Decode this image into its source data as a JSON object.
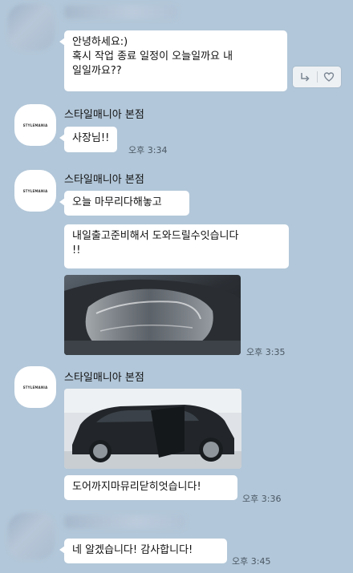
{
  "messages": {
    "m1": {
      "text": "안녕하세요:)\n혹시 작업 종료 일정이 오늘일까요 내\n일일까요??"
    },
    "group1": {
      "sender": "스타일매니아 본점",
      "b1": "사장님!!",
      "time": "오후 3:34"
    },
    "group2": {
      "sender": "스타일매니아 본점",
      "b1": "오늘 마무리다해놓고",
      "b2": "내일출고준비해서 도와드릴수잇습니다\n!!",
      "time": "오후 3:35"
    },
    "group3": {
      "sender": "스타일매니아 본점",
      "b1": "도어까지마뮤리닫히엇습니다!",
      "time": "오후 3:36"
    },
    "m_last": {
      "text": "네 알겠습니다! 감사합니다!",
      "time": "오후 3:45"
    }
  },
  "actions": {
    "reply_icon": "reply-arrow",
    "like_icon": "heart-outline"
  },
  "colors": {
    "background": "#b2c7d9",
    "bubble": "#ffffff"
  }
}
